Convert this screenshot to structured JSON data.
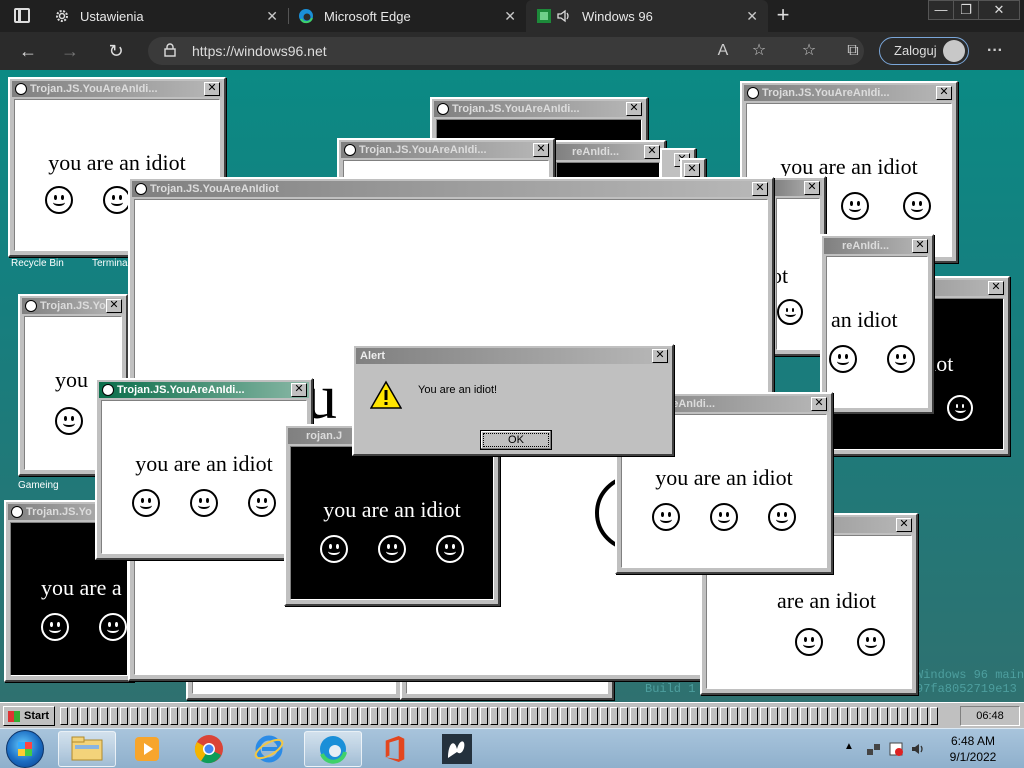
{
  "browser": {
    "tabs": [
      {
        "label": "Ustawienia",
        "icon": "gear-icon"
      },
      {
        "label": "Microsoft Edge",
        "icon": "edge-icon"
      },
      {
        "label": "Windows 96",
        "icon": "windows96-icon"
      }
    ],
    "url": "https://windows96.net",
    "login_label": "Zaloguj",
    "new_tab": "+",
    "more": "···"
  },
  "desktop": {
    "icons": [
      "Recycle Bin",
      "Terminal",
      "Gameing"
    ],
    "build_lines": [
      "Windows 96 main",
      "Build 1",
      "97fa8052719e13"
    ]
  },
  "windows": {
    "title_full": "Trojan.JS.YouAreAnIdiot",
    "title_trunc": "Trojan.JS.YouAreAnIdi...",
    "title_short": "Trojan.JS.Yo",
    "message": "you are an idiot",
    "message_partial_1": "you are a",
    "message_partial_2": "you",
    "message_partial_3": "ot",
    "message_partial_4": "an idiot",
    "message_partial_5": "idiot",
    "message_partial_6": "are an idiot",
    "message_partial_7": "u",
    "title_frag_1": ".YouAreAnIdi...",
    "title_frag_2": "reAnIdi...",
    "title_frag_3": "rojan.J",
    "title_frag_4": "Trojan.J"
  },
  "alert": {
    "title": "Alert",
    "message": "You are an idiot!",
    "ok": "OK"
  },
  "w96taskbar": {
    "start": "Start",
    "clock": "06:48"
  },
  "win7taskbar": {
    "time": "6:48 AM",
    "date": "9/1/2022"
  }
}
